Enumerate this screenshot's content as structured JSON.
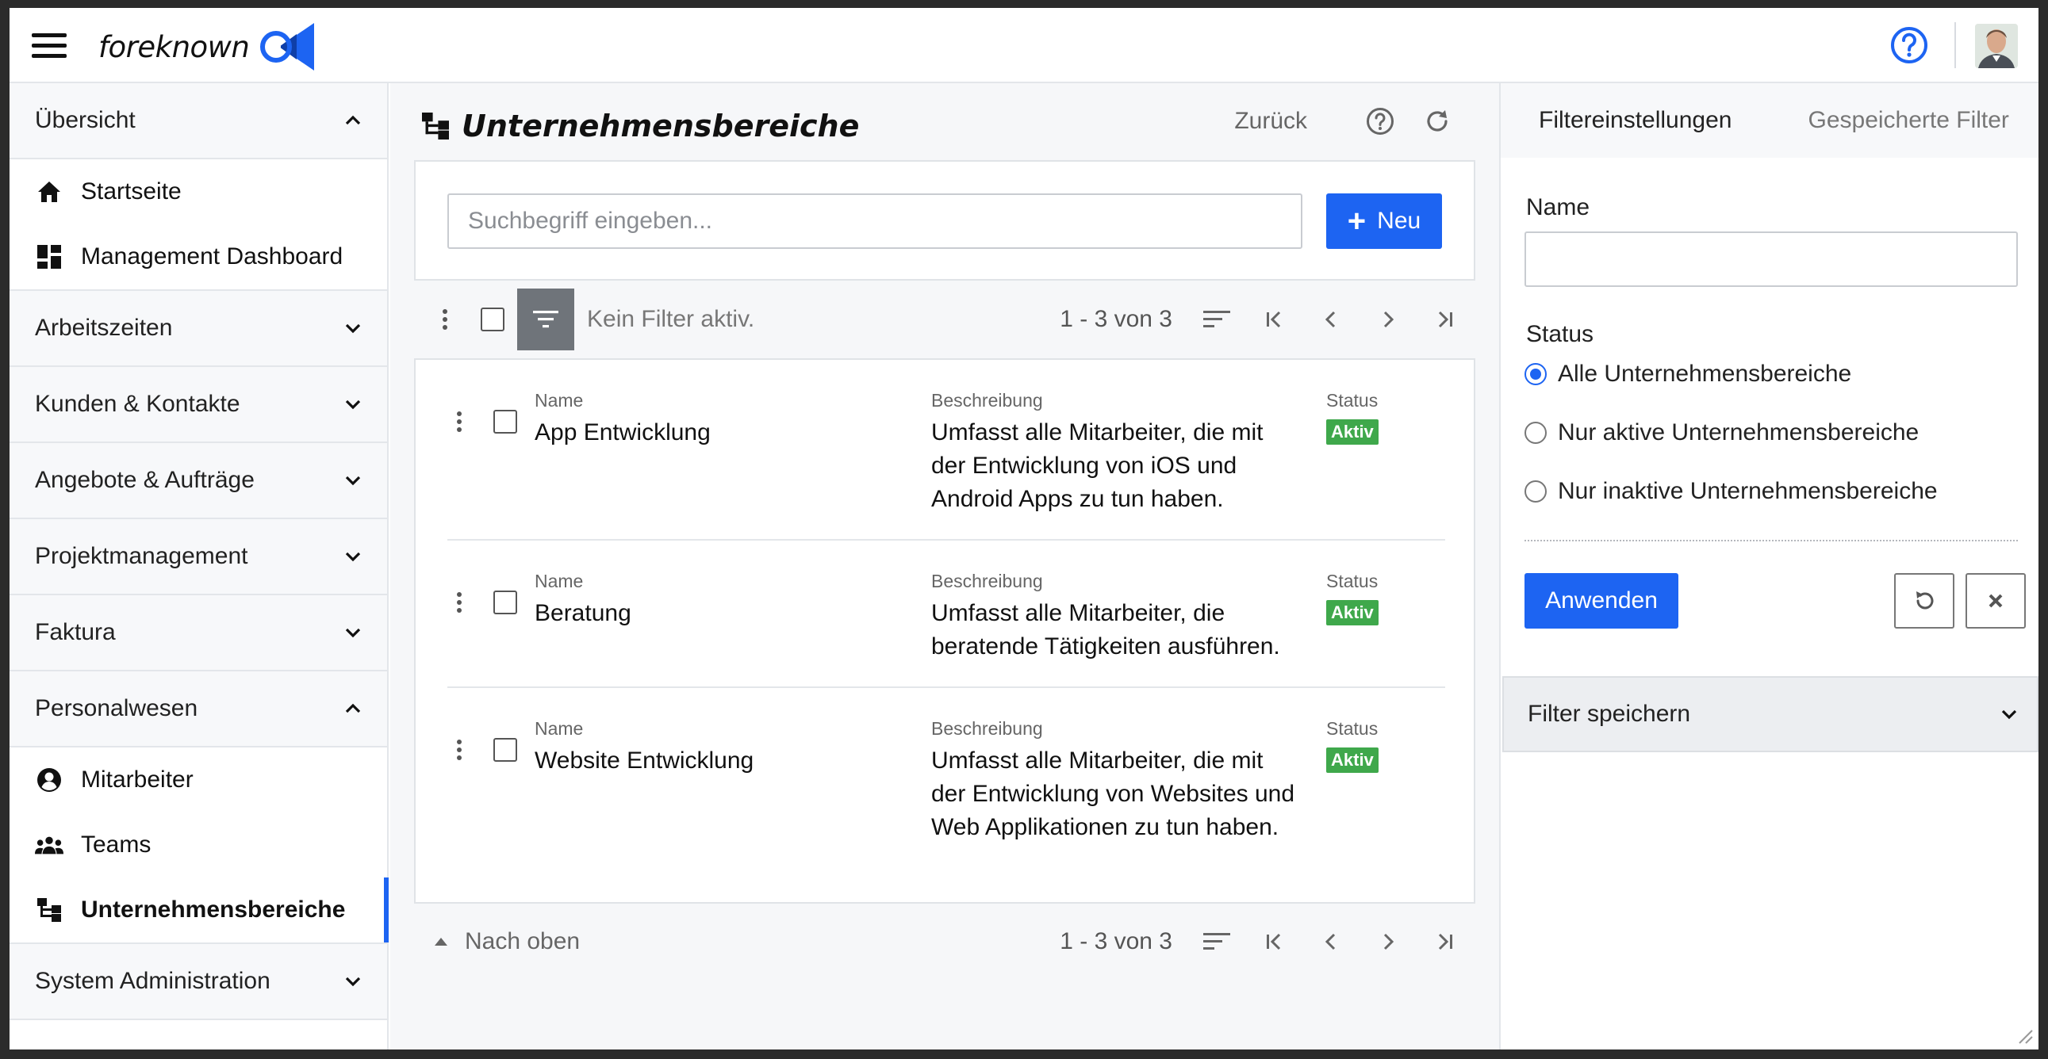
{
  "brand": {
    "name": "foreknown"
  },
  "colors": {
    "accent": "#1d64f2",
    "success": "#3fa84b",
    "filter_bg": "#6f747a"
  },
  "sidebar": {
    "sections": [
      {
        "label": "Übersicht",
        "expanded": true,
        "items": [
          {
            "label": "Startseite",
            "icon": "home-icon"
          },
          {
            "label": "Management Dashboard",
            "icon": "dashboard-icon"
          }
        ]
      },
      {
        "label": "Arbeitszeiten",
        "expanded": false
      },
      {
        "label": "Kunden & Kontakte",
        "expanded": false
      },
      {
        "label": "Angebote & Aufträge",
        "expanded": false
      },
      {
        "label": "Projektmanagement",
        "expanded": false
      },
      {
        "label": "Faktura",
        "expanded": false
      },
      {
        "label": "Personalwesen",
        "expanded": true,
        "items": [
          {
            "label": "Mitarbeiter",
            "icon": "person-circle-icon"
          },
          {
            "label": "Teams",
            "icon": "group-icon"
          },
          {
            "label": "Unternehmensbereiche",
            "icon": "hierarchy-icon",
            "active": true
          }
        ]
      },
      {
        "label": "System Administration",
        "expanded": false
      }
    ]
  },
  "main": {
    "title": "Unternehmensbereiche",
    "back_label": "Zurück",
    "search_placeholder": "Suchbegriff eingeben...",
    "new_label": "Neu",
    "filter_status": "Kein Filter aktiv.",
    "pager_count": "1 - 3 von 3",
    "to_top_label": "Nach oben",
    "columns": {
      "name": "Name",
      "description": "Beschreibung",
      "status": "Status"
    },
    "rows": [
      {
        "name": "App Entwicklung",
        "description": "Umfasst alle Mitarbeiter, die mit der Entwicklung von iOS und Android Apps zu tun haben.",
        "status": "Aktiv"
      },
      {
        "name": "Beratung",
        "description": "Umfasst alle Mitarbeiter, die beratende Tätigkeiten ausführen.",
        "status": "Aktiv"
      },
      {
        "name": "Website Entwicklung",
        "description": "Umfasst alle Mitarbeiter, die mit der Entwicklung von Websites und Web Applikationen zu tun haben.",
        "status": "Aktiv"
      }
    ]
  },
  "filter_panel": {
    "tabs": [
      "Filtereinstellungen",
      "Gespeicherte Filter"
    ],
    "name_label": "Name",
    "name_value": "",
    "status_label": "Status",
    "status_options": [
      "Alle Unternehmensbereiche",
      "Nur aktive Unternehmensbereiche",
      "Nur inaktive Unternehmensbereiche"
    ],
    "status_selected": 0,
    "apply_label": "Anwenden",
    "save_filter_label": "Filter speichern"
  }
}
